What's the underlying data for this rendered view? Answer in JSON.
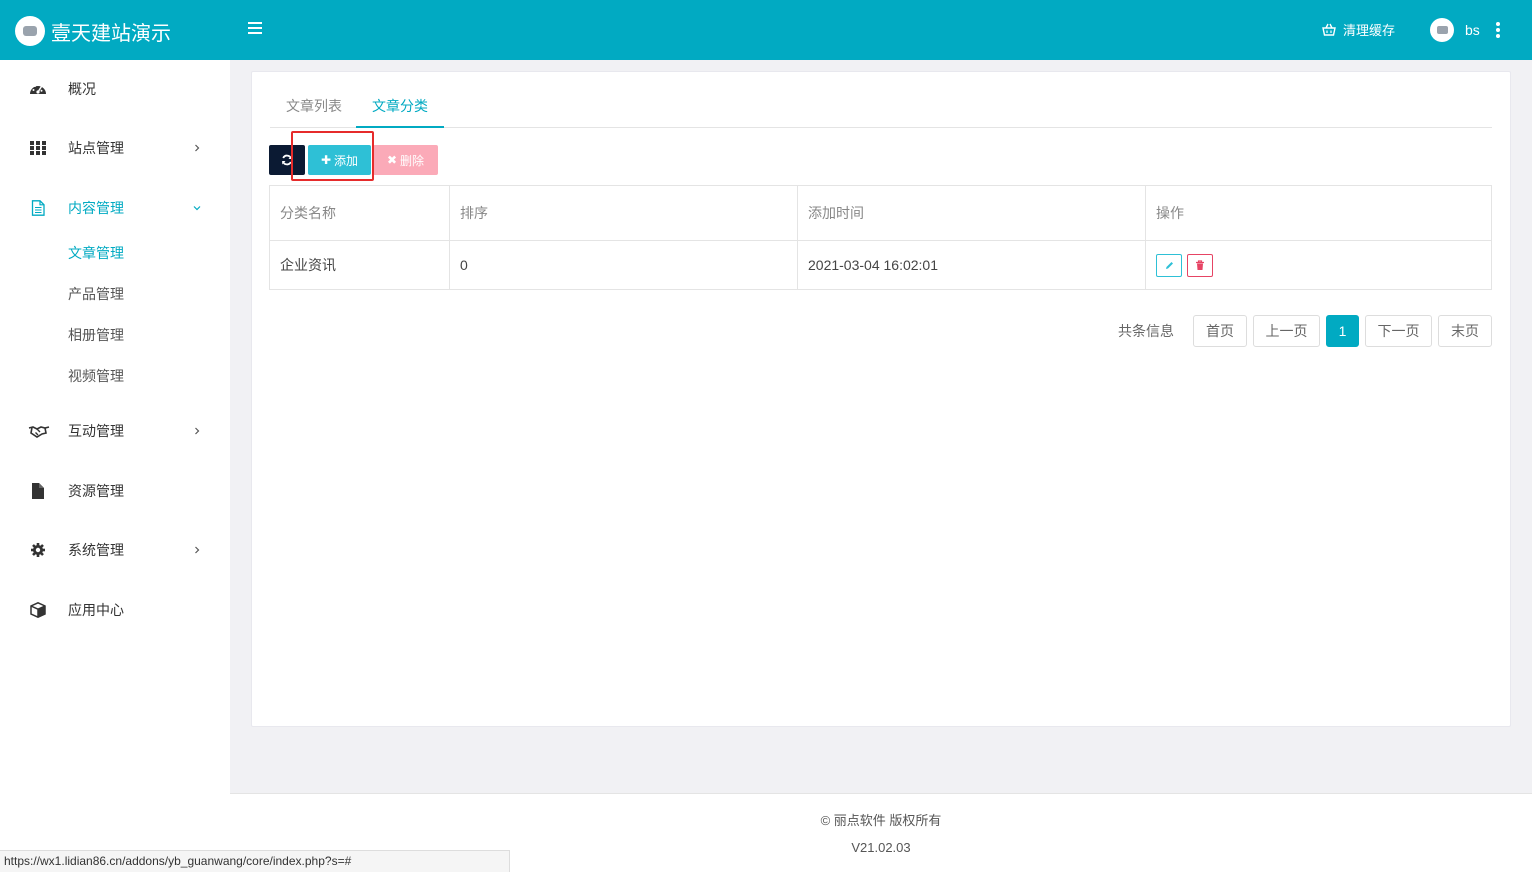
{
  "header": {
    "brand_title": "壹天建站演示",
    "clear_cache_label": "清理缓存",
    "user_name": "bs",
    "accent_color": "#01aac2"
  },
  "sidebar": {
    "items": [
      {
        "label": "概况",
        "icon": "dashboard-icon"
      },
      {
        "label": "站点管理",
        "icon": "grid-icon"
      },
      {
        "label": "内容管理",
        "icon": "document-icon"
      },
      {
        "label": "互动管理",
        "icon": "handshake-icon"
      },
      {
        "label": "资源管理",
        "icon": "file-icon"
      },
      {
        "label": "系统管理",
        "icon": "gear-icon"
      },
      {
        "label": "应用中心",
        "icon": "cube-icon"
      }
    ],
    "content_sub": [
      {
        "label": "文章管理"
      },
      {
        "label": "产品管理"
      },
      {
        "label": "相册管理"
      },
      {
        "label": "视频管理"
      }
    ]
  },
  "tabs": [
    {
      "label": "文章列表"
    },
    {
      "label": "文章分类"
    }
  ],
  "toolbar": {
    "add_label": "添加",
    "delete_label": "删除"
  },
  "table": {
    "columns": [
      "分类名称",
      "排序",
      "添加时间",
      "操作"
    ],
    "rows": [
      {
        "name": "企业资讯",
        "sort": "0",
        "time": "2021-03-04 16:02:01"
      }
    ]
  },
  "pagination": {
    "total_text": "共条信息",
    "first": "首页",
    "prev": "上一页",
    "current": "1",
    "next": "下一页",
    "last": "末页"
  },
  "footer": {
    "copyright": "© 丽点软件 版权所有",
    "version": "V21.02.03"
  },
  "statusbar": {
    "url": "https://wx1.lidian86.cn/addons/yb_guanwang/core/index.php?s=#"
  }
}
